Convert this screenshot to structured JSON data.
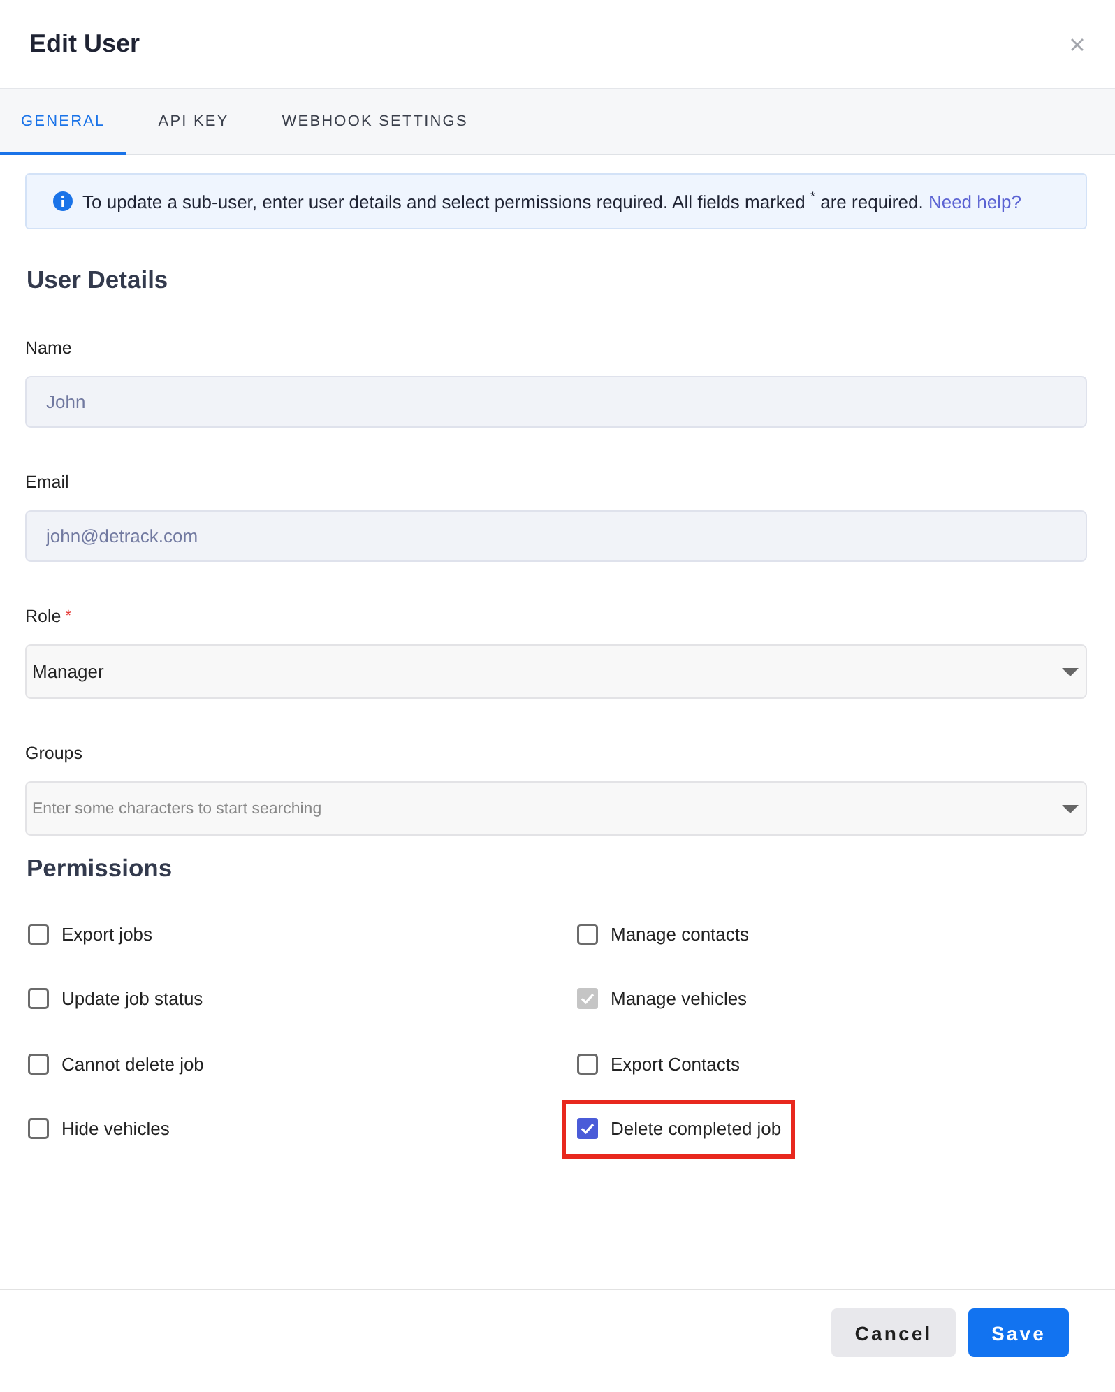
{
  "window": {
    "title": "Edit User"
  },
  "tabs": [
    {
      "label": "GENERAL",
      "selected": true
    },
    {
      "label": "API KEY",
      "selected": false
    },
    {
      "label": "WEBHOOK SETTINGS",
      "selected": false
    }
  ],
  "notice": {
    "text": "To update a sub-user, enter user details and select permissions required. All fields marked $^{*}$ are required.",
    "link": "Need help?"
  },
  "user_details": {
    "heading": "User Details",
    "fields": [
      {
        "kind": "text",
        "label": "Name",
        "value": "John",
        "disabled": true
      },
      {
        "kind": "text",
        "label": "Email",
        "value": "john@detrack.com",
        "disabled": true
      },
      {
        "kind": "select",
        "label": "Role",
        "required_mark": "*",
        "value": "Manager",
        "disabled": false
      },
      {
        "kind": "select",
        "label": "Groups",
        "placeholder": "Enter some characters to start searching",
        "disabled": false
      }
    ]
  },
  "permissions": {
    "heading": "Permissions",
    "items": [
      {
        "label": "Export jobs",
        "checked": false,
        "disabled": false,
        "highlighted": false
      },
      {
        "label": "Manage contacts",
        "checked": false,
        "disabled": false,
        "highlighted": false
      },
      {
        "label": "Update job status",
        "checked": false,
        "disabled": false,
        "highlighted": false
      },
      {
        "label": "Manage vehicles",
        "checked": true,
        "disabled": true,
        "highlighted": false
      },
      {
        "label": "Cannot delete job",
        "checked": false,
        "disabled": false,
        "highlighted": false
      },
      {
        "label": "Export Contacts",
        "checked": false,
        "disabled": false,
        "highlighted": false
      },
      {
        "label": "Hide vehicles",
        "checked": false,
        "disabled": false,
        "highlighted": false
      },
      {
        "label": "Delete completed job",
        "checked": true,
        "disabled": false,
        "highlighted": true
      }
    ]
  },
  "buttons": [
    {
      "label": "Cancel",
      "kind": "secondary"
    },
    {
      "label": "Save",
      "kind": "primary"
    }
  ]
}
